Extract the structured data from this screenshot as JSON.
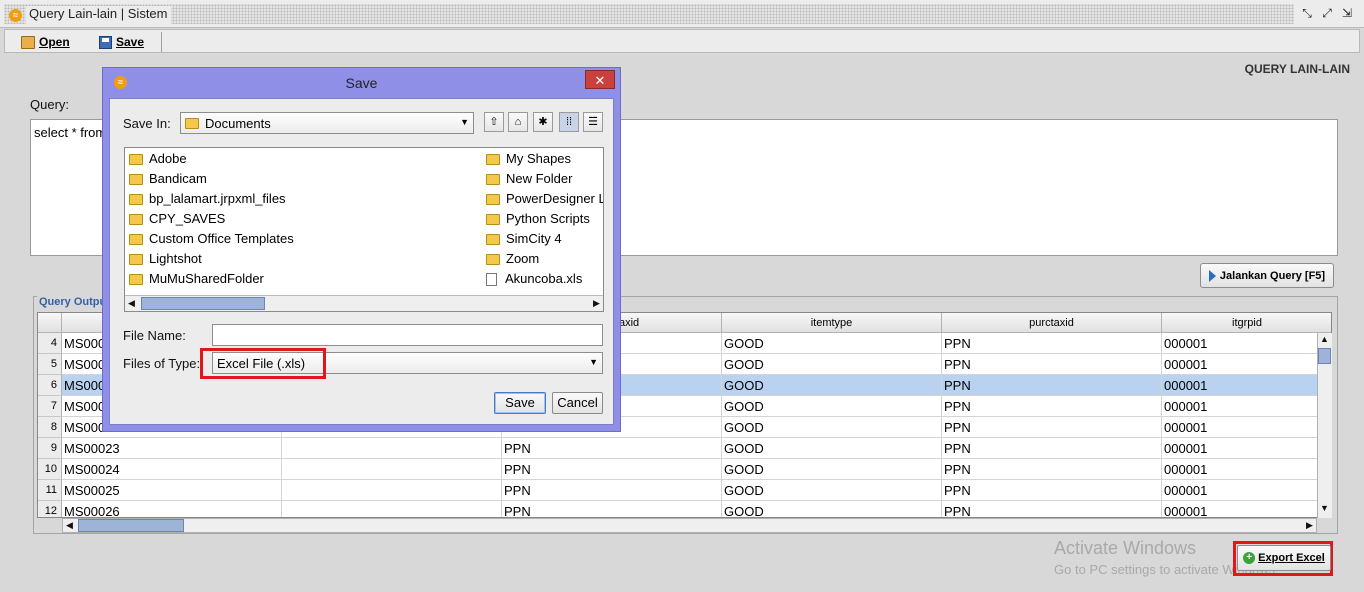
{
  "window": {
    "title": "Query Lain-lain | Sistem",
    "controls": [
      "restore-icon",
      "maximize-icon",
      "close-icon"
    ]
  },
  "toolbar": {
    "open_label": "Open",
    "save_label": "Save"
  },
  "panel": {
    "title": "QUERY LAIN-LAIN",
    "query_label": "Query:",
    "query_text": "select * from",
    "run_button": "Jalankan Query [F5]",
    "output_label": "Query Output",
    "export_button": "Export Excel"
  },
  "table": {
    "columns": [
      "",
      "",
      "",
      "axid",
      "itemtype",
      "purctaxid",
      "itgrpid"
    ],
    "rows": [
      {
        "num": "4",
        "c1": "MS000",
        "c2": "",
        "c3": "",
        "itemtype": "GOOD",
        "purctaxid": "PPN",
        "itgrpid": "000001"
      },
      {
        "num": "5",
        "c1": "MS000",
        "c2": "",
        "c3": "",
        "itemtype": "GOOD",
        "purctaxid": "PPN",
        "itgrpid": "000001"
      },
      {
        "num": "6",
        "c1": "MS000",
        "c2": "",
        "c3": "",
        "itemtype": "GOOD",
        "purctaxid": "PPN",
        "itgrpid": "000001"
      },
      {
        "num": "7",
        "c1": "MS000",
        "c2": "",
        "c3": "",
        "itemtype": "GOOD",
        "purctaxid": "PPN",
        "itgrpid": "000001"
      },
      {
        "num": "8",
        "c1": "MS000",
        "c2": "",
        "c3": "",
        "itemtype": "GOOD",
        "purctaxid": "PPN",
        "itgrpid": "000001"
      },
      {
        "num": "9",
        "c1": "MS00023",
        "c2": "",
        "c3": "PPN",
        "itemtype": "GOOD",
        "purctaxid": "PPN",
        "itgrpid": "000001"
      },
      {
        "num": "10",
        "c1": "MS00024",
        "c2": "",
        "c3": "PPN",
        "itemtype": "GOOD",
        "purctaxid": "PPN",
        "itgrpid": "000001"
      },
      {
        "num": "11",
        "c1": "MS00025",
        "c2": "",
        "c3": "PPN",
        "itemtype": "GOOD",
        "purctaxid": "PPN",
        "itgrpid": "000001"
      },
      {
        "num": "12",
        "c1": "MS00026",
        "c2": "",
        "c3": "PPN",
        "itemtype": "GOOD",
        "purctaxid": "PPN",
        "itgrpid": "000001"
      }
    ],
    "selected_row": "6"
  },
  "watermark": {
    "line1": "Activate Windows",
    "line2": "Go to PC settings to activate Windows."
  },
  "dialog": {
    "title": "Save",
    "close": "✕",
    "save_in_label": "Save In:",
    "save_in_value": "Documents",
    "files_left": [
      "Adobe",
      "Bandicam",
      "bp_lalamart.jrpxml_files",
      "CPY_SAVES",
      "Custom Office Templates",
      "Lightshot",
      "MuMuSharedFolder"
    ],
    "files_right": [
      "My Shapes",
      "New Folder",
      "PowerDesigner Li",
      "Python Scripts",
      "SimCity 4",
      "Zoom",
      "Akuncoba.xls"
    ],
    "file_name_label": "File Name:",
    "file_name_value": "",
    "file_type_label": "Files of Type:",
    "file_type_value": "Excel File (.xls)",
    "save_button": "Save",
    "cancel_button": "Cancel"
  },
  "colors": {
    "highlight": "#e0161a",
    "selection": "#b8d2f0",
    "dialog_frame": "#8f8fe8"
  }
}
